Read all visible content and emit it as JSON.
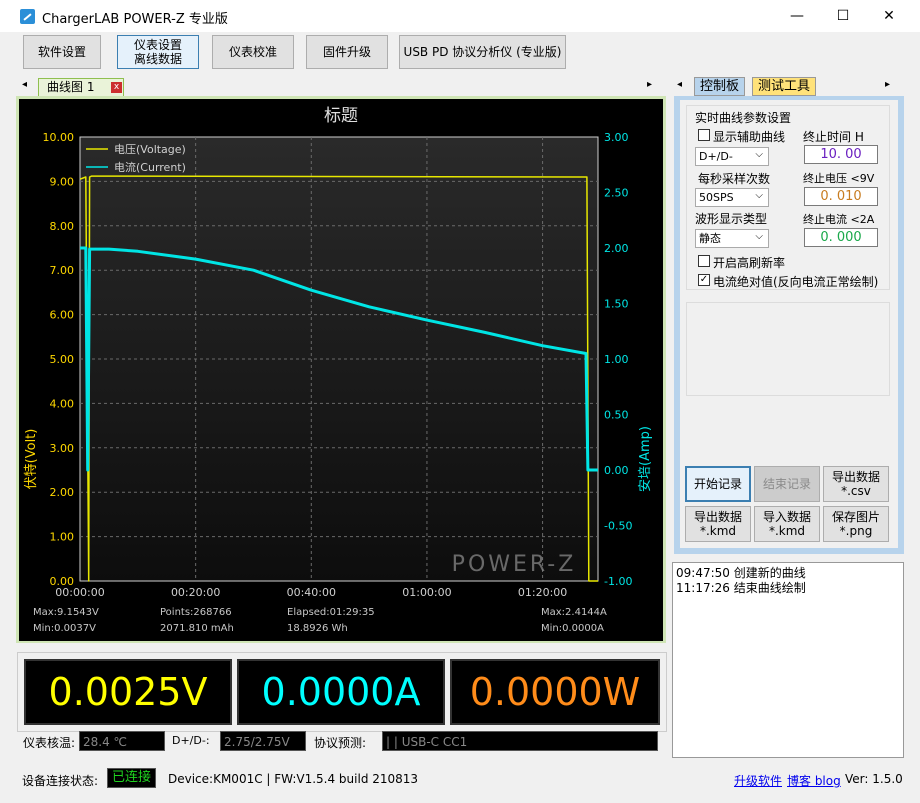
{
  "window": {
    "title": "ChargerLAB POWER-Z 专业版",
    "minimize": "—",
    "maximize": "☐",
    "close": "✕"
  },
  "toolbar": {
    "software_settings": "软件设置",
    "meter_settings_l1": "仪表设置",
    "meter_settings_l2": "离线数据",
    "meter_calibrate": "仪表校准",
    "firmware_upgrade": "固件升级",
    "pd_analyzer": "USB PD 协议分析仪 (专业版)"
  },
  "chart_tab": {
    "label": "曲线图 1",
    "close": "x"
  },
  "chart_data": {
    "type": "line",
    "title": "标题",
    "ylabel_left": "伏特(Volt)",
    "ylabel_right": "安培(Amp)",
    "ylim_left": [
      0,
      10
    ],
    "ylim_right": [
      -1,
      3
    ],
    "y_ticks_left": [
      "10.00",
      "9.00",
      "8.00",
      "7.00",
      "6.00",
      "5.00",
      "4.00",
      "3.00",
      "2.00",
      "1.00",
      "0.00"
    ],
    "y_ticks_right": [
      "3.00",
      "2.50",
      "2.00",
      "1.50",
      "1.00",
      "0.50",
      "0.00",
      "-0.50",
      "-1.00"
    ],
    "x_ticks": [
      "00:00:00",
      "00:20:00",
      "00:40:00",
      "01:00:00",
      "01:20:00"
    ],
    "x_unit": "elapsed time",
    "xlim": [
      "00:00:00",
      "01:29:35"
    ],
    "grid": true,
    "legend_position": "top-left",
    "series": [
      {
        "name": "电压(Voltage)",
        "color": "#e8e800",
        "axis": "left",
        "x": [
          "00:00:00",
          "00:01:00",
          "00:01:30",
          "00:01:40",
          "00:02:00",
          "01:27:40",
          "01:28:00",
          "01:29:35"
        ],
        "values": [
          9.05,
          9.1,
          0.0,
          9.1,
          9.12,
          9.1,
          0.0,
          0.0
        ]
      },
      {
        "name": "电流(Current)",
        "color": "#00e5e5",
        "axis": "right",
        "x": [
          "00:00:00",
          "00:01:00",
          "00:01:20",
          "00:01:40",
          "00:05:00",
          "00:10:00",
          "00:20:00",
          "00:30:00",
          "00:40:00",
          "00:50:00",
          "01:00:00",
          "01:10:00",
          "01:20:00",
          "01:27:30",
          "01:27:50",
          "01:29:35"
        ],
        "values": [
          2.0,
          2.0,
          0.0,
          1.99,
          1.99,
          1.97,
          1.9,
          1.8,
          1.62,
          1.47,
          1.35,
          1.24,
          1.12,
          1.05,
          0.0,
          0.0
        ]
      }
    ],
    "watermark": "POWER-Z"
  },
  "stats": {
    "max_v": "Max:9.1543V",
    "min_v": "Min:0.0037V",
    "points": "Points:268766",
    "mah": "2071.810 mAh",
    "elapsed": "Elapsed:01:29:35",
    "wh": "18.8926 Wh",
    "max_a": "Max:2.4144A",
    "min_a": "Min:0.0000A"
  },
  "readouts": {
    "voltage": "0.0025V",
    "current": "0.0000A",
    "power": "0.0000W",
    "voltage_color": "#ffff00",
    "current_color": "#00ffff",
    "power_color": "#ff8c1a"
  },
  "info_row": {
    "temp_label": "仪表核温:",
    "temp_value": "28.4 ℃",
    "dpdm_label": "D+/D-:",
    "dpdm_value": "2.75/2.75V",
    "protocol_label": "协议预测:",
    "protocol_value": "| | USB-C CC1"
  },
  "right_tabs": {
    "control": "控制板",
    "test": "测试工具"
  },
  "curve_params": {
    "group_title": "实时曲线参数设置",
    "show_aux": "显示辅助曲线",
    "aux_select": "D+/D-",
    "sample_label": "每秒采样次数",
    "sample_select": "50SPS",
    "wave_label": "波形显示类型",
    "wave_select": "静态",
    "high_refresh": "开启高刷新率",
    "abs_current": "电流绝对值(反向电流正常绘制)",
    "end_time_label": "终止时间 H",
    "end_time_value": "10. 00",
    "end_voltage_label": "终止电压 <9V",
    "end_voltage_value": "0. 010",
    "end_current_label": "终止电流 <2A",
    "end_current_value": "0. 000"
  },
  "record_buttons": {
    "start": "开始记录",
    "stop": "结束记录",
    "export_csv_l1": "导出数据",
    "export_csv_l2": "*.csv",
    "export_kmd_l1": "导出数据",
    "export_kmd_l2": "*.kmd",
    "import_kmd_l1": "导入数据",
    "import_kmd_l2": "*.kmd",
    "save_png_l1": "保存图片",
    "save_png_l2": "*.png"
  },
  "log": {
    "line1": "09:47:50 创建新的曲线",
    "line2": "11:17:26 结束曲线绘制"
  },
  "status": {
    "conn_label": "设备连接状态:",
    "conn_value": "已连接",
    "device": "Device:KM001C | FW:V1.5.4 build 210813",
    "upgrade": "升级软件",
    "blog": "博客 blog",
    "version": "Ver: 1.5.0"
  }
}
